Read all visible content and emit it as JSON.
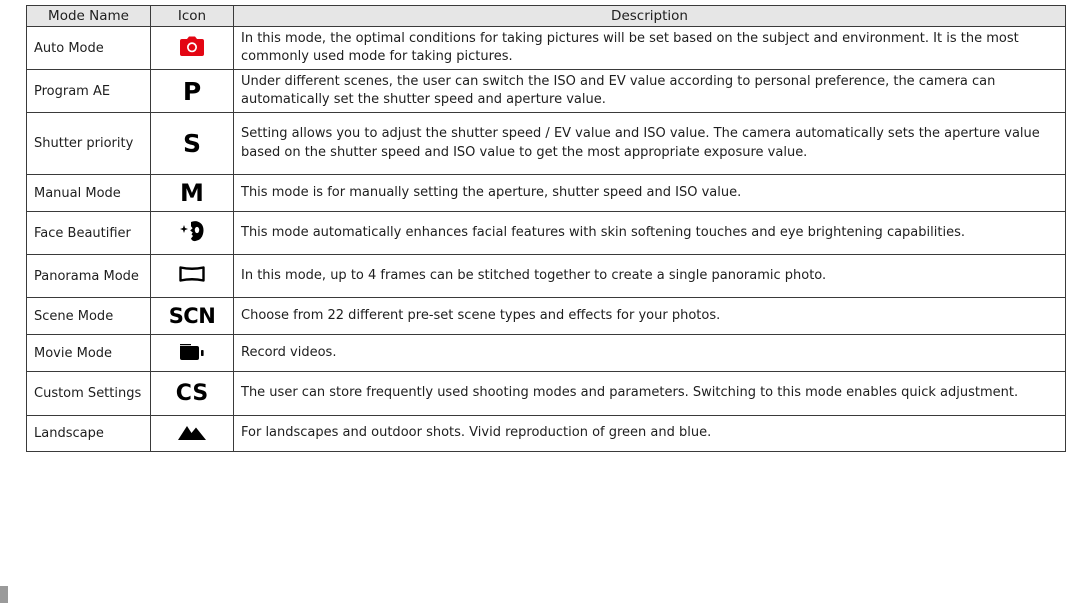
{
  "headers": {
    "mode_name": "Mode Name",
    "icon": "Icon",
    "description": "Description"
  },
  "colors": {
    "accent_red": "#e30613",
    "icon_black": "#000000",
    "header_bg": "#e6e6e6",
    "border": "#3a3a3a"
  },
  "rows": [
    {
      "name": "Auto Mode",
      "icon": "camera-icon",
      "icon_text": "",
      "description": "In this mode, the optimal conditions for taking pictures will be set based on the subject and environment. It is the most commonly used mode for taking pictures."
    },
    {
      "name": "Program AE",
      "icon": "program-p-icon",
      "icon_text": "P",
      "description": "Under different scenes, the user can switch the ISO and EV value according to personal preference, the camera can automatically set the shutter speed and aperture value."
    },
    {
      "name": "Shutter priority",
      "icon": "shutter-s-icon",
      "icon_text": "S",
      "description": "Setting allows you to adjust the shutter speed / EV value and ISO value. The camera automatically sets the aperture value based on the shutter speed and ISO value to get the most appropriate exposure value."
    },
    {
      "name": "Manual Mode",
      "icon": "manual-m-icon",
      "icon_text": "M",
      "description": "This mode is for manually setting the aperture, shutter speed and ISO value."
    },
    {
      "name": "Face Beautifier",
      "icon": "face-beautifier-icon",
      "icon_text": "",
      "description": "This mode automatically enhances facial features with skin softening touches and eye brightening capabilities."
    },
    {
      "name": "Panorama Mode",
      "icon": "panorama-icon",
      "icon_text": "",
      "description": "In this mode, up to 4 frames can be stitched together to create a single panoramic photo."
    },
    {
      "name": "Scene Mode",
      "icon": "scene-scn-icon",
      "icon_text": "SCN",
      "description": "Choose from 22 different pre-set scene types and effects for your photos."
    },
    {
      "name": "Movie Mode",
      "icon": "movie-camera-icon",
      "icon_text": "",
      "description": "Record videos."
    },
    {
      "name": "Custom Settings",
      "icon": "custom-cs-icon",
      "icon_text": "CS",
      "description": "The user can store frequently used shooting modes and parameters. Switching to this mode enables quick adjustment."
    },
    {
      "name": "Landscape",
      "icon": "landscape-mountain-icon",
      "icon_text": "",
      "description": "For landscapes and outdoor shots. Vivid reproduction of green and blue."
    }
  ]
}
